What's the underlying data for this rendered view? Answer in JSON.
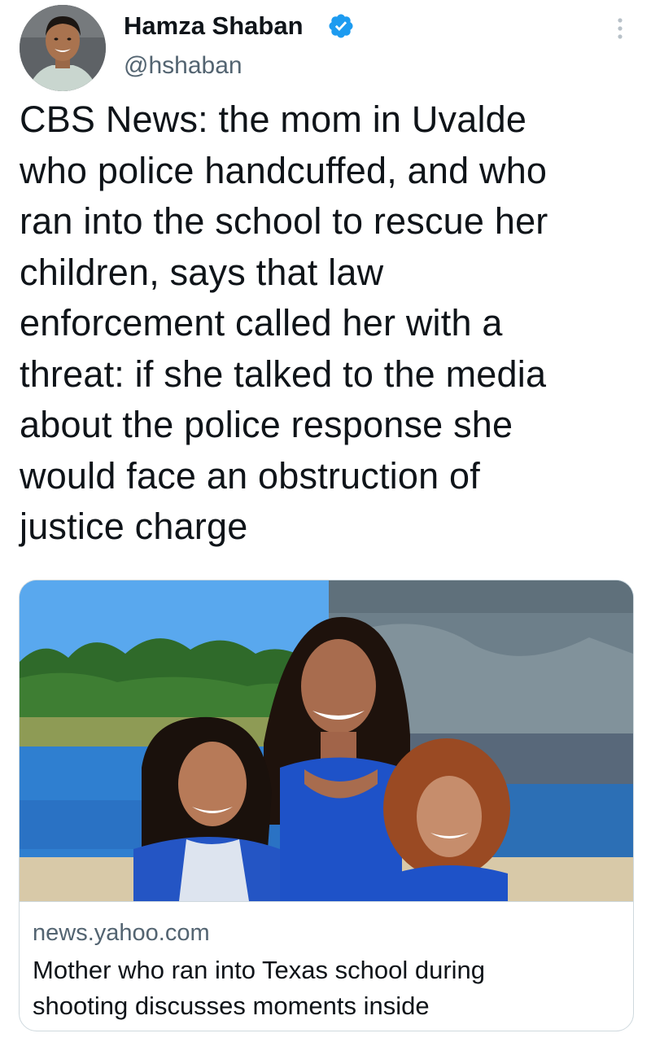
{
  "author": {
    "name": "Hamza Shaban",
    "handle": "@hshaban",
    "verified": true
  },
  "tweet": {
    "text": "CBS News: the mom in Uvalde\nwho police handcuffed, and who\nran into the school to rescue her\nchildren, says that law\nenforcement called her with a\nthreat: if she talked to the media\nabout the police response she\nwould face an obstruction of\njustice charge"
  },
  "link_card": {
    "domain": "news.yahoo.com",
    "title": "Mother who ran into Texas school during\nshooting discusses moments inside",
    "image_desc": "photo-mother-and-two-daughters"
  },
  "icons": {
    "verified": "verified-badge-icon",
    "more": "more-options-icon"
  },
  "colors": {
    "verified_blue": "#1d9bf0",
    "secondary_text": "#536471",
    "primary_text": "#0f1419",
    "border": "#cfd9de"
  }
}
